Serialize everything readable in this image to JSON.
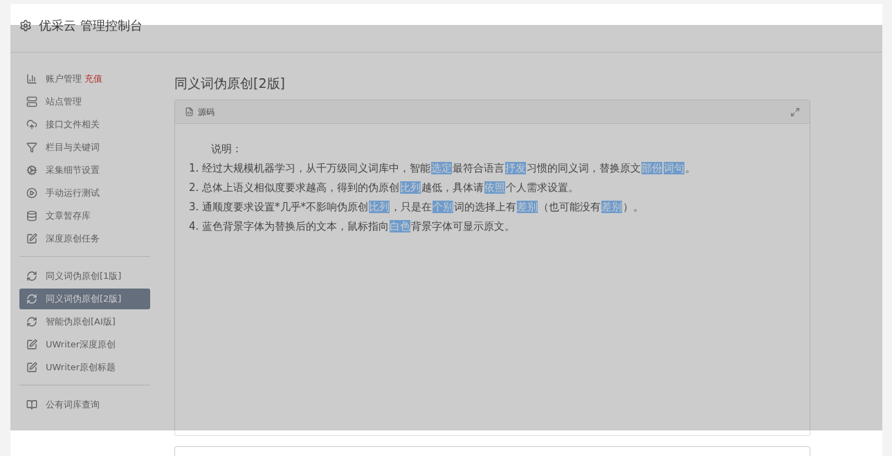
{
  "header": {
    "title": "优采云 管理控制台"
  },
  "sidebar": {
    "groups": [
      [
        {
          "label": "账户管理",
          "badge": "充值",
          "selected": false
        },
        {
          "label": "站点管理",
          "selected": false
        },
        {
          "label": "接口文件相关",
          "selected": false
        },
        {
          "label": "栏目与关键词",
          "selected": false
        },
        {
          "label": "采集细节设置",
          "selected": false
        },
        {
          "label": "手动运行测试",
          "selected": false
        },
        {
          "label": "文章暂存库",
          "selected": false
        },
        {
          "label": "深度原创任务",
          "selected": false
        }
      ],
      [
        {
          "label": "同义词伪原创[1版]",
          "selected": false
        },
        {
          "label": "同义词伪原创[2版]",
          "selected": true
        },
        {
          "label": "智能伪原创[AI版]",
          "selected": false
        },
        {
          "label": "UWriter深度原创",
          "selected": false
        },
        {
          "label": "UWriter原创标题",
          "selected": false
        }
      ],
      [
        {
          "label": "公有词库查询",
          "selected": false
        }
      ]
    ]
  },
  "main": {
    "title": "同义词伪原创[2版]",
    "panel": {
      "title": "源码",
      "intro": "说明：",
      "lines": [
        [
          {
            "text": "1. 经过大规模机器学习，从千万级同义词库中，智能",
            "replaced": false
          },
          {
            "text": "选定",
            "replaced": true
          },
          {
            "text": "最符合语言",
            "replaced": false
          },
          {
            "text": "抒发",
            "replaced": true
          },
          {
            "text": "习惯的同义词，替换原文",
            "replaced": false
          },
          {
            "text": "部份",
            "replaced": true
          },
          {
            "text": "词句",
            "replaced": true
          },
          {
            "text": "。",
            "replaced": false
          }
        ],
        [
          {
            "text": "2. 总体上语义相似度要求越高，得到的伪原创",
            "replaced": false
          },
          {
            "text": "比列",
            "replaced": true
          },
          {
            "text": "越低，具体请",
            "replaced": false
          },
          {
            "text": "依照",
            "replaced": true
          },
          {
            "text": "个人需求设置。",
            "replaced": false
          }
        ],
        [
          {
            "text": "3. 通顺度要求设置*几乎*不影响伪原创",
            "replaced": false
          },
          {
            "text": "比列",
            "replaced": true
          },
          {
            "text": "，只是在",
            "replaced": false
          },
          {
            "text": "个别",
            "replaced": true
          },
          {
            "text": "词的选择上有",
            "replaced": false
          },
          {
            "text": "差别",
            "replaced": true
          },
          {
            "text": "（也可能没有",
            "replaced": false
          },
          {
            "text": "差别",
            "replaced": true
          },
          {
            "text": "）。",
            "replaced": false
          }
        ],
        [
          {
            "text": "4. 蓝色背景字体为替换后的文本，鼠标指向",
            "replaced": false
          },
          {
            "text": "白色",
            "replaced": true
          },
          {
            "text": "背景字体可显示原文。",
            "replaced": false
          }
        ]
      ]
    }
  }
}
